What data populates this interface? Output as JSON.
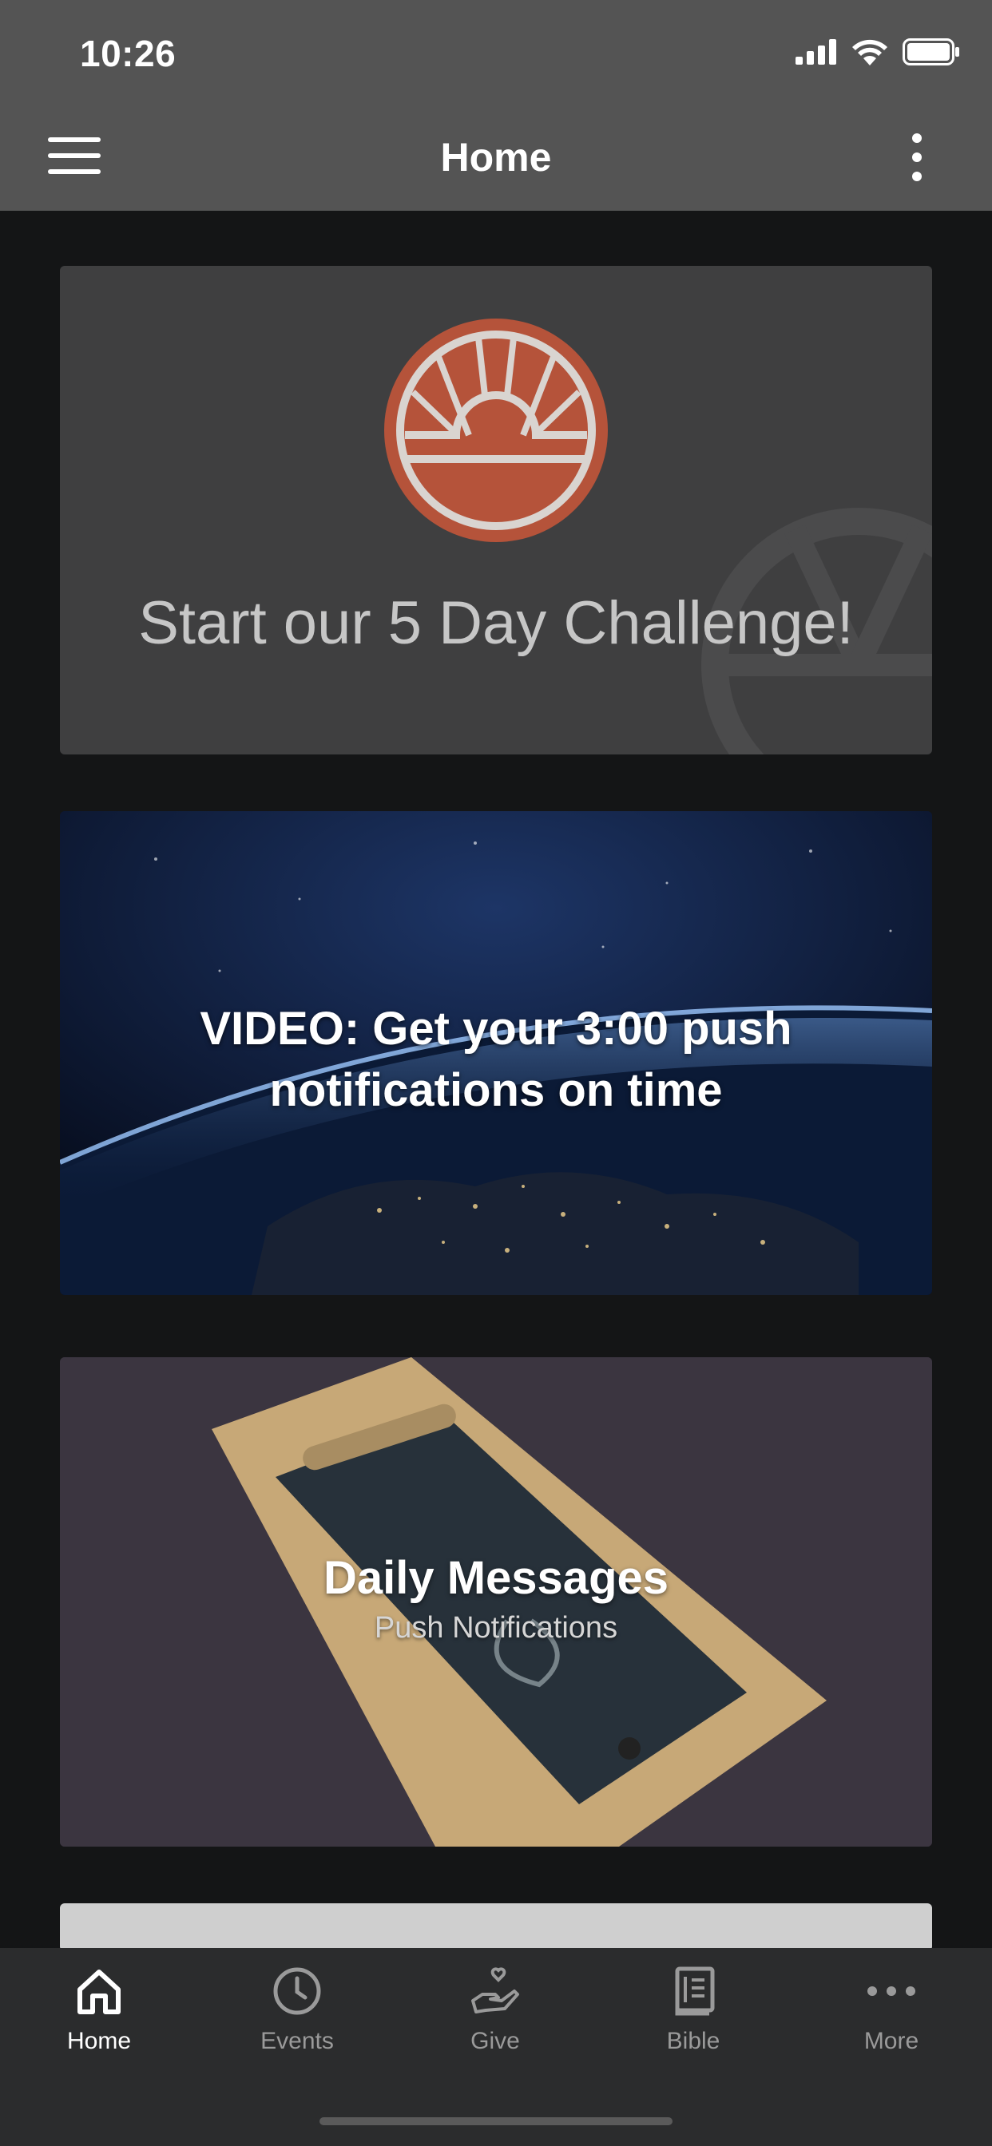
{
  "status_bar": {
    "time": "10:26"
  },
  "nav": {
    "title": "Home"
  },
  "cards": {
    "challenge": {
      "title": "Start our 5 Day Challenge!",
      "logo_color": "#b5533a"
    },
    "video": {
      "title": "VIDEO: Get your 3:00 push notifications on time"
    },
    "daily": {
      "title": "Daily Messages",
      "subtitle": "Push Notifications"
    }
  },
  "tabs": [
    {
      "label": "Home",
      "icon": "home-icon",
      "active": true
    },
    {
      "label": "Events",
      "icon": "clock-icon",
      "active": false
    },
    {
      "label": "Give",
      "icon": "give-hand-heart-icon",
      "active": false
    },
    {
      "label": "Bible",
      "icon": "book-icon",
      "active": false
    },
    {
      "label": "More",
      "icon": "more-dots-icon",
      "active": false
    }
  ]
}
